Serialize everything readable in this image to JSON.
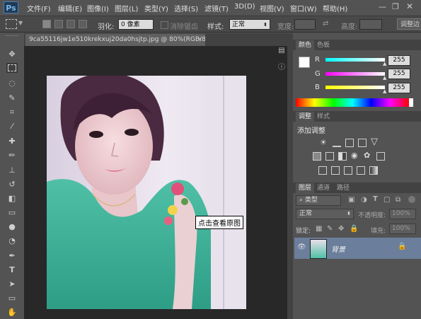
{
  "app": {
    "logo": "Ps"
  },
  "menu": [
    "文件(F)",
    "编辑(E)",
    "图像(I)",
    "图层(L)",
    "类型(Y)",
    "选择(S)",
    "滤镜(T)",
    "3D(D)",
    "视图(V)",
    "窗口(W)",
    "帮助(H)"
  ],
  "options": {
    "feather_label": "羽化:",
    "feather_value": "0 像素",
    "antialias_label": "消除锯齿",
    "style_label": "样式:",
    "style_value": "正常",
    "width_label": "宽度:",
    "height_label": "高度:",
    "refine_edge": "调整边"
  },
  "document": {
    "tab_title": "9ca55116jw1e510krekxuj20da0hsjtp.jpg @ 80%(RGB/8#) *",
    "close": "×"
  },
  "tooltip": "点击查看原图",
  "color_panel": {
    "tabs": [
      "颜色",
      "色板"
    ],
    "channels": [
      {
        "label": "R",
        "value": "255"
      },
      {
        "label": "G",
        "value": "255"
      },
      {
        "label": "B",
        "value": "255"
      }
    ]
  },
  "adjust_panel": {
    "tabs": [
      "调整",
      "样式"
    ],
    "title": "添加调整"
  },
  "layers_panel": {
    "tabs": [
      "图层",
      "通道",
      "路径"
    ],
    "filter_label": "类型",
    "blend_mode": "正常",
    "opacity_label": "不透明度:",
    "opacity_value": "100%",
    "lock_label": "锁定:",
    "fill_label": "填充:",
    "fill_value": "100%",
    "layer_name": "背景"
  },
  "colors": {
    "selected_layer": "#6b7e9c",
    "canvas_bg": "#282828"
  }
}
